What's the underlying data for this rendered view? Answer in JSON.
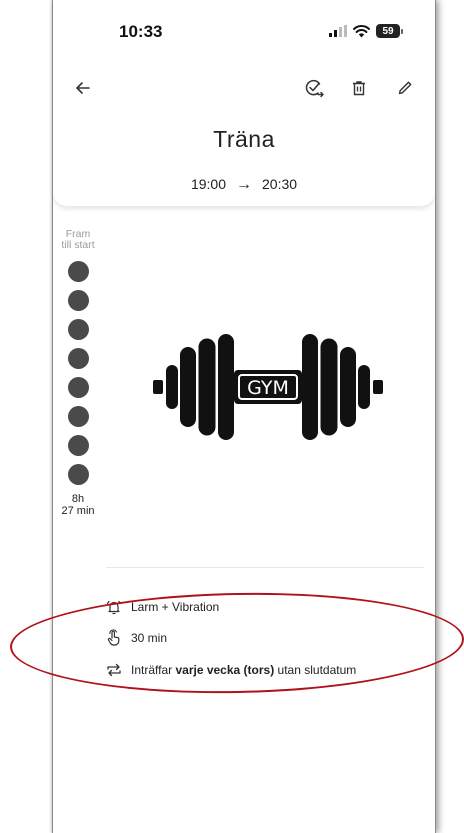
{
  "status_bar": {
    "time": "10:33",
    "battery": "59"
  },
  "toolbar": {
    "back_icon": "arrow-left-icon",
    "done_icon": "check-circle-arrow-icon",
    "delete_icon": "trash-icon",
    "edit_icon": "pencil-icon"
  },
  "event": {
    "title": "Träna",
    "start_time": "19:00",
    "end_time": "20:30",
    "image_label": "GYM"
  },
  "countdown": {
    "top_label_line1": "Fram",
    "top_label_line2": "till start",
    "bottom_label_line1": "8h",
    "bottom_label_line2": "27 min",
    "dot_count": 8
  },
  "details": {
    "alarm": "Larm + Vibration",
    "duration": "30 min",
    "recurrence_prefix": "Inträffar ",
    "recurrence_bold": "varje vecka (tors)",
    "recurrence_suffix": " utan slutdatum"
  },
  "colors": {
    "annotation": "#b0121a",
    "dot": "#4a4a4a",
    "text": "#1f1f1f"
  }
}
